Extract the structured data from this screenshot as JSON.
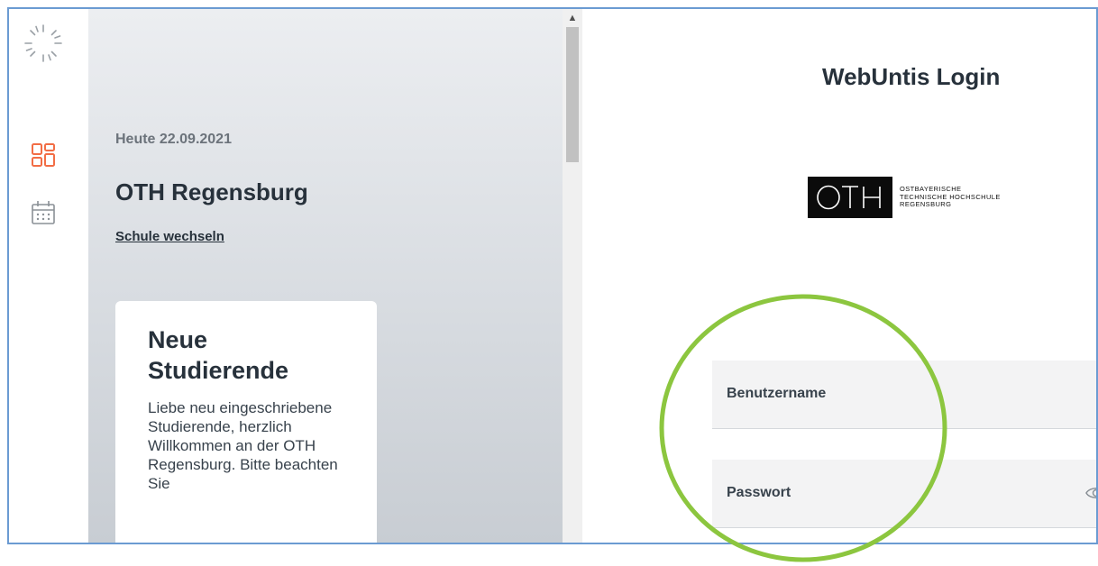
{
  "sidebar": {
    "icons": [
      "loading-spinner-icon",
      "dashboard-icon",
      "calendar-icon"
    ],
    "active_color": "#f26d45",
    "inactive_color": "#8a9096"
  },
  "panel": {
    "date_label": "Heute 22.09.2021",
    "school_name": "OTH Regensburg",
    "switch_school_link": "Schule wechseln",
    "news": {
      "title": "Neue Studierende",
      "body": "Liebe neu eingeschriebene Studierende, herzlich Willkommen an der OTH Regensburg. Bitte beachten Sie"
    }
  },
  "login": {
    "title": "WebUntis Login",
    "logo": {
      "mark": "OTH",
      "text_lines": [
        "OSTBAYERISCHE",
        "TECHNISCHE HOCHSCHULE",
        "REGENSBURG"
      ]
    },
    "username_label": "Benutzername",
    "password_label": "Passwort"
  },
  "annotation": {
    "highlight_color": "#8cc63f"
  }
}
